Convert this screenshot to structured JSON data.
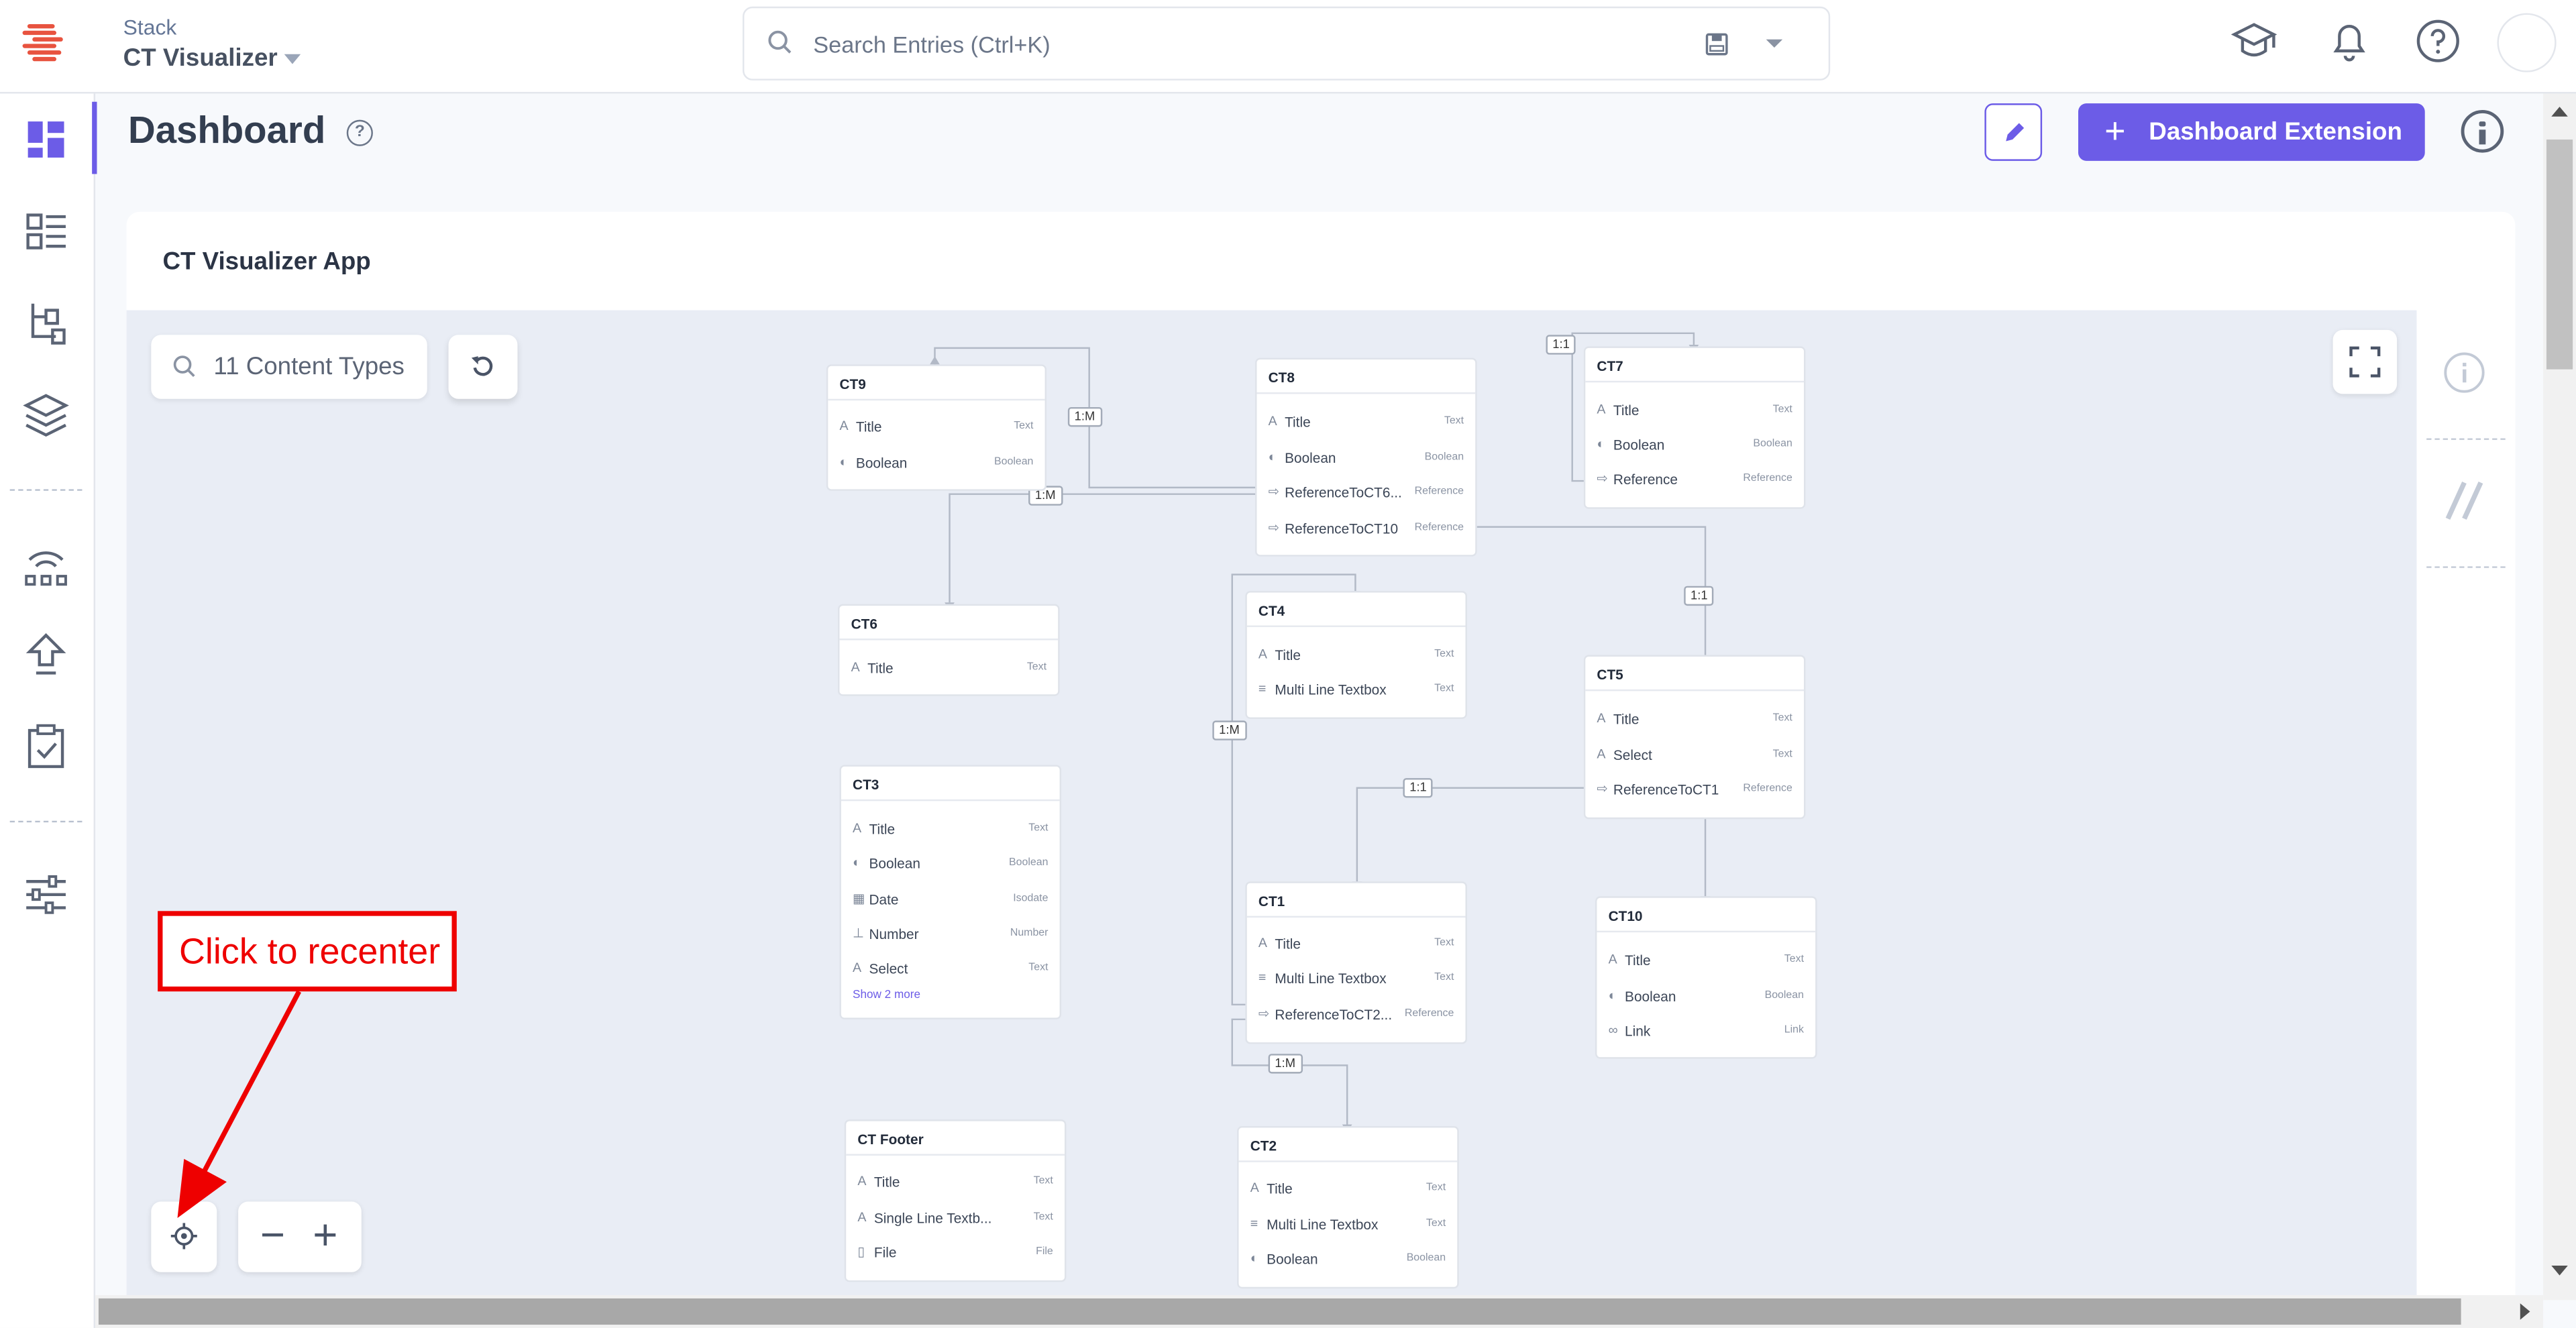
{
  "header": {
    "stack_label": "Stack",
    "stack_name": "CT Visualizer",
    "search_placeholder": "Search Entries (Ctrl+K)"
  },
  "page": {
    "title": "Dashboard",
    "edit_icon": "pencil-icon",
    "extension_button": "Dashboard Extension"
  },
  "card": {
    "title": "CT Visualizer App",
    "search_label": "11 Content Types"
  },
  "annotation": "Click to recenter",
  "nodes": {
    "ct9": {
      "title": "CT9",
      "fields": [
        {
          "name": "Title",
          "type": "Text"
        },
        {
          "name": "Boolean",
          "type": "Boolean"
        }
      ]
    },
    "ct8": {
      "title": "CT8",
      "fields": [
        {
          "name": "Title",
          "type": "Text"
        },
        {
          "name": "Boolean",
          "type": "Boolean"
        },
        {
          "name": "ReferenceToCT6...",
          "type": "Reference"
        },
        {
          "name": "ReferenceToCT10",
          "type": "Reference"
        }
      ]
    },
    "ct7": {
      "title": "CT7",
      "fields": [
        {
          "name": "Title",
          "type": "Text"
        },
        {
          "name": "Boolean",
          "type": "Boolean"
        },
        {
          "name": "Reference",
          "type": "Reference"
        }
      ]
    },
    "ct6": {
      "title": "CT6",
      "fields": [
        {
          "name": "Title",
          "type": "Text"
        }
      ]
    },
    "ct4": {
      "title": "CT4",
      "fields": [
        {
          "name": "Title",
          "type": "Text"
        },
        {
          "name": "Multi Line Textbox",
          "type": "Text"
        }
      ]
    },
    "ct5": {
      "title": "CT5",
      "fields": [
        {
          "name": "Title",
          "type": "Text"
        },
        {
          "name": "Select",
          "type": "Text"
        },
        {
          "name": "ReferenceToCT1",
          "type": "Reference"
        }
      ]
    },
    "ct3": {
      "title": "CT3",
      "fields": [
        {
          "name": "Title",
          "type": "Text"
        },
        {
          "name": "Boolean",
          "type": "Boolean"
        },
        {
          "name": "Date",
          "type": "Isodate"
        },
        {
          "name": "Number",
          "type": "Number"
        },
        {
          "name": "Select",
          "type": "Text"
        }
      ],
      "show_more": "Show 2 more"
    },
    "ct1": {
      "title": "CT1",
      "fields": [
        {
          "name": "Title",
          "type": "Text"
        },
        {
          "name": "Multi Line Textbox",
          "type": "Text"
        },
        {
          "name": "ReferenceToCT2...",
          "type": "Reference"
        }
      ]
    },
    "ct10": {
      "title": "CT10",
      "fields": [
        {
          "name": "Title",
          "type": "Text"
        },
        {
          "name": "Boolean",
          "type": "Boolean"
        },
        {
          "name": "Link",
          "type": "Link"
        }
      ]
    },
    "ctfooter": {
      "title": "CT Footer",
      "fields": [
        {
          "name": "Title",
          "type": "Text"
        },
        {
          "name": "Single Line Textb...",
          "type": "Text"
        },
        {
          "name": "File",
          "type": "File"
        }
      ]
    },
    "ct2": {
      "title": "CT2",
      "fields": [
        {
          "name": "Title",
          "type": "Text"
        },
        {
          "name": "Multi Line Textbox",
          "type": "Text"
        },
        {
          "name": "Boolean",
          "type": "Boolean"
        }
      ]
    }
  },
  "relations": {
    "r1": "1:M",
    "r2": "1:M",
    "r3": "1:1",
    "r4": "1:1",
    "r5": "1:M",
    "r6": "1:1",
    "r7": "1:M"
  },
  "colors": {
    "accent": "#6c5ce7",
    "annotation": "#ee0000"
  }
}
